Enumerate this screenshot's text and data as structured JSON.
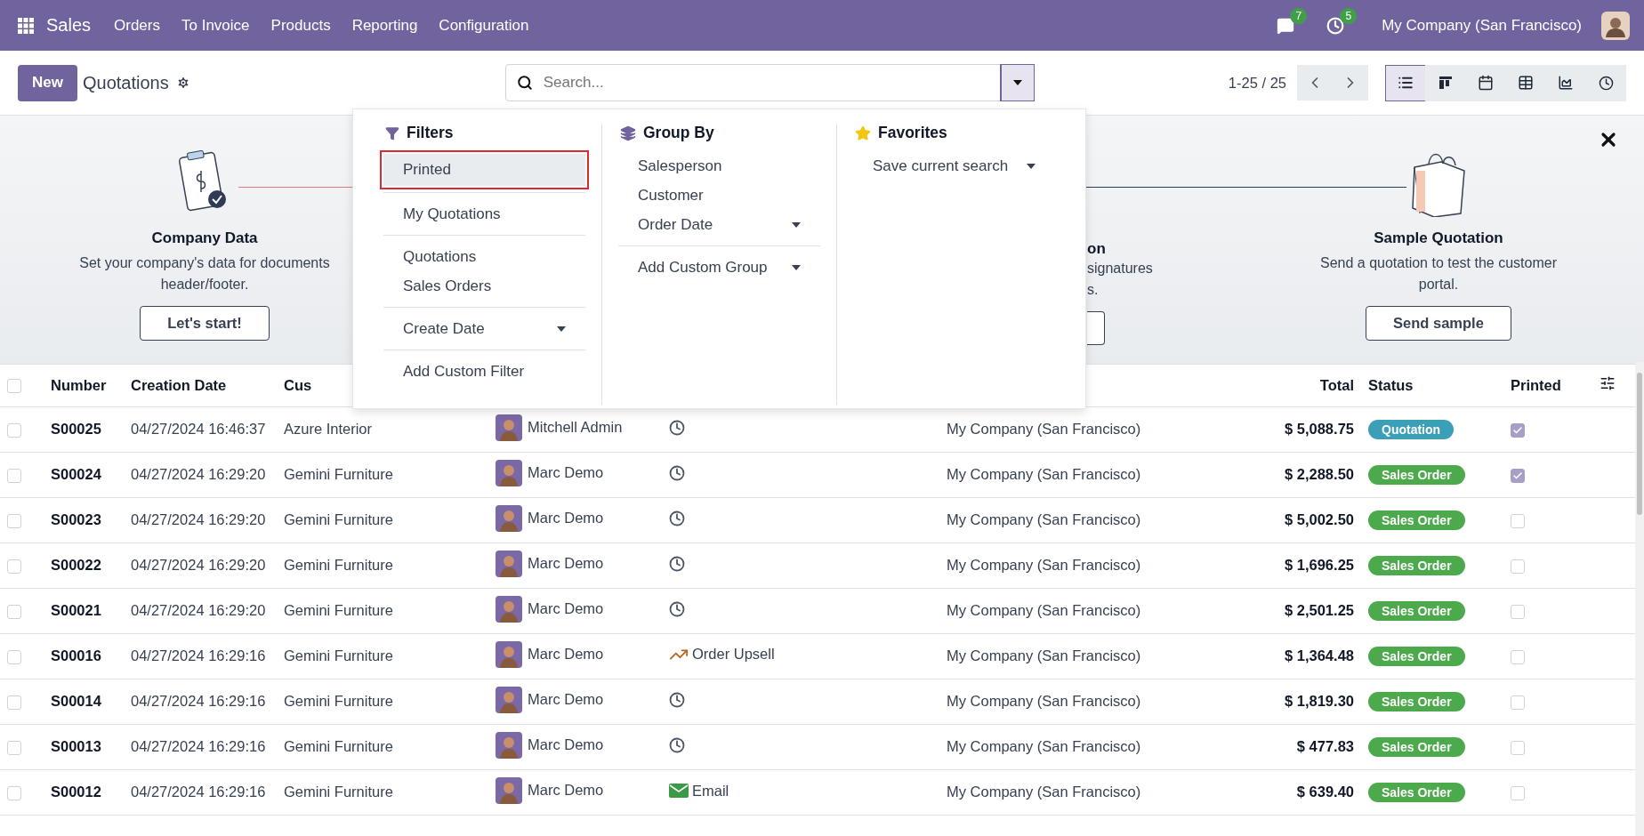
{
  "navbar": {
    "app": "Sales",
    "menu": [
      "Orders",
      "To Invoice",
      "Products",
      "Reporting",
      "Configuration"
    ],
    "messages_badge": "7",
    "activities_badge": "5",
    "company": "My Company (San Francisco)"
  },
  "control_panel": {
    "new_button": "New",
    "title": "Quotations",
    "search": {
      "placeholder": "Search..."
    },
    "pager": "1-25 / 25",
    "views": [
      {
        "kind": "list",
        "selected": true
      },
      {
        "kind": "kanban",
        "selected": false
      },
      {
        "kind": "calendar",
        "selected": false
      },
      {
        "kind": "pivot",
        "selected": false
      },
      {
        "kind": "graph",
        "selected": false
      },
      {
        "kind": "activity",
        "selected": false
      }
    ]
  },
  "onboarding": {
    "steps": [
      {
        "kind": "full",
        "title": "Company Data",
        "description": "Set your company's data for documents header/footer.",
        "button": "Let's start!"
      },
      {
        "kind": "partial",
        "title": "on",
        "lines": [
          "signatures",
          "s."
        ]
      },
      {
        "kind": "full",
        "title": "Sample Quotation",
        "description": "Send a quotation to test the customer portal.",
        "button": "Send sample"
      }
    ]
  },
  "search_panel": {
    "filters": {
      "title": "Filters",
      "groups": [
        [
          {
            "label": "Printed",
            "highlighted": true
          }
        ],
        [
          {
            "label": "My Quotations",
            "highlighted": false
          }
        ],
        [
          {
            "label": "Quotations",
            "highlighted": false
          },
          {
            "label": "Sales Orders",
            "highlighted": false
          }
        ],
        [
          {
            "label": "Create Date",
            "highlighted": false,
            "has_menu": true
          }
        ],
        [
          {
            "label": "Add Custom Filter",
            "highlighted": false
          }
        ]
      ]
    },
    "group_by": {
      "title": "Group By",
      "groups": [
        [
          {
            "label": "Salesperson"
          },
          {
            "label": "Customer"
          },
          {
            "label": "Order Date",
            "has_menu": true
          }
        ],
        [
          {
            "label": "Add Custom Group",
            "has_menu": true
          }
        ]
      ]
    },
    "favorites": {
      "title": "Favorites",
      "items": [
        {
          "label": "Save current search",
          "has_menu": true
        }
      ]
    }
  },
  "table": {
    "select_all_checked": false,
    "columns": [
      "Number",
      "Creation Date",
      "Cus",
      "Total",
      "Status",
      "Printed"
    ],
    "rows": [
      {
        "selected": false,
        "number": "S00025",
        "date": "04/27/2024 16:46:37",
        "customer": "Azure Interior",
        "salesperson": "Mitchell Admin",
        "activity": {
          "kind": "clock"
        },
        "company": "My Company (San Francisco)",
        "total": "$ 5,088.75",
        "status": {
          "label": "Quotation",
          "color": "#3c9fb8"
        },
        "printed": true
      },
      {
        "selected": false,
        "number": "S00024",
        "date": "04/27/2024 16:29:20",
        "customer": "Gemini Furniture",
        "salesperson": "Marc Demo",
        "activity": {
          "kind": "clock"
        },
        "company": "My Company (San Francisco)",
        "total": "$ 2,288.50",
        "status": {
          "label": "Sales Order",
          "color": "#4caa4c"
        },
        "printed": true
      },
      {
        "selected": false,
        "number": "S00023",
        "date": "04/27/2024 16:29:20",
        "customer": "Gemini Furniture",
        "salesperson": "Marc Demo",
        "activity": {
          "kind": "clock"
        },
        "company": "My Company (San Francisco)",
        "total": "$ 5,002.50",
        "status": {
          "label": "Sales Order",
          "color": "#4caa4c"
        },
        "printed": false
      },
      {
        "selected": false,
        "number": "S00022",
        "date": "04/27/2024 16:29:20",
        "customer": "Gemini Furniture",
        "salesperson": "Marc Demo",
        "activity": {
          "kind": "clock"
        },
        "company": "My Company (San Francisco)",
        "total": "$ 1,696.25",
        "status": {
          "label": "Sales Order",
          "color": "#4caa4c"
        },
        "printed": false
      },
      {
        "selected": false,
        "number": "S00021",
        "date": "04/27/2024 16:29:20",
        "customer": "Gemini Furniture",
        "salesperson": "Marc Demo",
        "activity": {
          "kind": "clock"
        },
        "company": "My Company (San Francisco)",
        "total": "$ 2,501.25",
        "status": {
          "label": "Sales Order",
          "color": "#4caa4c"
        },
        "printed": false
      },
      {
        "selected": false,
        "number": "S00016",
        "date": "04/27/2024 16:29:16",
        "customer": "Gemini Furniture",
        "salesperson": "Marc Demo",
        "activity": {
          "kind": "upsell",
          "label": "Order Upsell"
        },
        "company": "My Company (San Francisco)",
        "total": "$ 1,364.48",
        "status": {
          "label": "Sales Order",
          "color": "#4caa4c"
        },
        "printed": false
      },
      {
        "selected": false,
        "number": "S00014",
        "date": "04/27/2024 16:29:16",
        "customer": "Gemini Furniture",
        "salesperson": "Marc Demo",
        "activity": {
          "kind": "clock"
        },
        "company": "My Company (San Francisco)",
        "total": "$ 1,819.30",
        "status": {
          "label": "Sales Order",
          "color": "#4caa4c"
        },
        "printed": false
      },
      {
        "selected": false,
        "number": "S00013",
        "date": "04/27/2024 16:29:16",
        "customer": "Gemini Furniture",
        "salesperson": "Marc Demo",
        "activity": {
          "kind": "clock"
        },
        "company": "My Company (San Francisco)",
        "total": "$ 477.83",
        "status": {
          "label": "Sales Order",
          "color": "#4caa4c"
        },
        "printed": false
      },
      {
        "selected": false,
        "number": "S00012",
        "date": "04/27/2024 16:29:16",
        "customer": "Gemini Furniture",
        "salesperson": "Marc Demo",
        "activity": {
          "kind": "email",
          "label": "Email"
        },
        "company": "My Company (San Francisco)",
        "total": "$ 639.40",
        "status": {
          "label": "Sales Order",
          "color": "#4caa4c"
        },
        "printed": false
      }
    ]
  }
}
